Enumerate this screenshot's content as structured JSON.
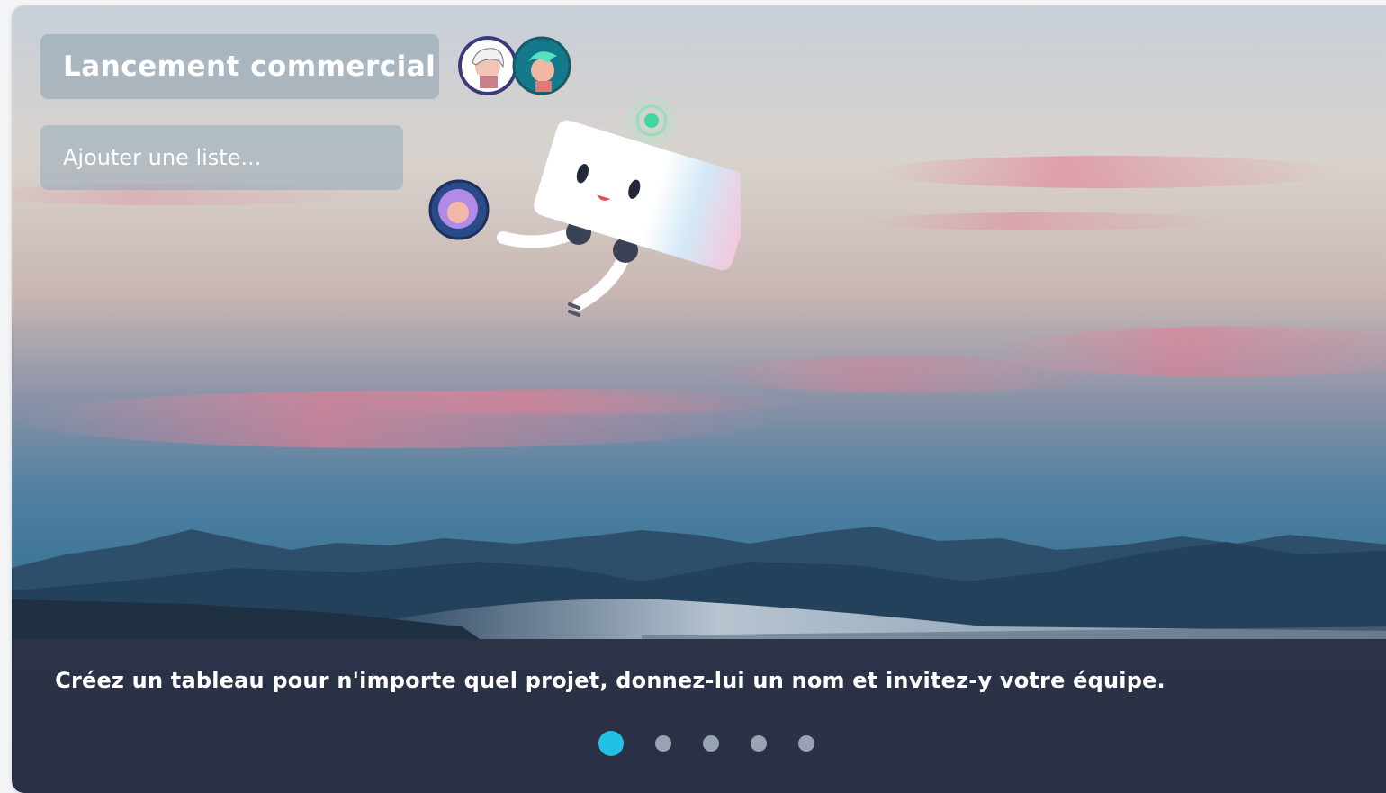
{
  "board": {
    "title": "Lancement commercial",
    "add_list_placeholder": "Ajouter une liste..."
  },
  "caption": "Créez un tableau pour n'importe quel projet, donnez-lui un nom et invitez-y votre équipe.",
  "carousel": {
    "slides": 5,
    "active_index": 0
  },
  "colors": {
    "accent": "#1fc2e3",
    "panel": "#2c3347",
    "dot_inactive": "#9aa3b2"
  }
}
